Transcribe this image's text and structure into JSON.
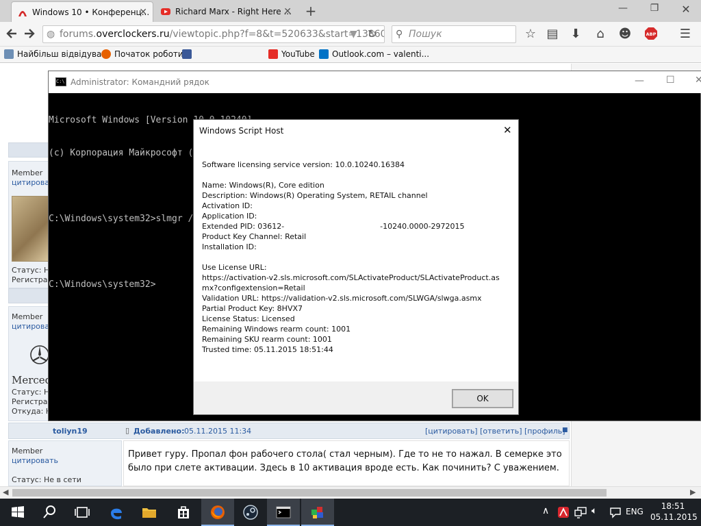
{
  "browser": {
    "tabs": [
      {
        "title": "Windows 10 • Конференц...",
        "active": true
      },
      {
        "title": "Richard Marx - Right Here ...",
        "active": false
      }
    ],
    "url_prefix": "forums.",
    "url_domain": "overclockers.ru",
    "url_path": "/viewtopic.php?f=8&t=520633&start=13860",
    "search_placeholder": "Пошук",
    "bookmarks": [
      "Найбільш відвідувані",
      "Початок роботи",
      "YouTube",
      "Outlook.com – valenti..."
    ]
  },
  "forum": {
    "posts": [
      {
        "role": "Member",
        "quote": "цитировать",
        "status": "Статус: Н",
        "reg": "Регистрац"
      },
      {
        "role": "Member",
        "quote": "цитировать",
        "avatar_text": "Mercede",
        "status": "Статус: Н",
        "reg": "Регистрац",
        "from": "Откуда: Н"
      }
    ],
    "last_post": {
      "author": "toliyn19",
      "added_label": "Добавлено:",
      "added_date": "05.11.2015 11:34",
      "actions": "[цитировать] [ответить] [профиль]",
      "role": "Member",
      "quote": "цитировать",
      "status": "Статус: Не в сети",
      "text_line1": "Привет гуру. Пропал фон рабочего стола( стал черным). Где то не то нажал. В семерке это",
      "text_line2": "было при слете активации. Здесь в 10 активация вроде есть. Как починить? С уважением."
    }
  },
  "cmd": {
    "title": "Administrator: Командний рядок",
    "lines": [
      "Microsoft Windows [Version 10.0.10240]",
      "(c) Корпорация Майкрософт (Microsoft Corporation), 2015 р. Усі права захищені.",
      "",
      "C:\\Windows\\system32>slmgr /",
      "",
      "C:\\Windows\\system32>"
    ]
  },
  "dialog": {
    "title": "Windows Script Host",
    "body": "Software licensing service version: 10.0.10240.16384\n\nName: Windows(R), Core edition\nDescription: Windows(R) Operating System, RETAIL channel\nActivation ID: \nApplication ID: \nExtended PID: 03612-                                        -10240.0000-2972015\nProduct Key Channel: Retail\nInstallation ID: \n\nUse License URL:\nhttps://activation-v2.sls.microsoft.com/SLActivateProduct/SLActivateProduct.as\nmx?configextension=Retail\nValidation URL: https://validation-v2.sls.microsoft.com/SLWGA/slwga.asmx\nPartial Product Key: 8HVX7\nLicense Status: Licensed\nRemaining Windows rearm count: 1001\nRemaining SKU rearm count: 1001\nTrusted time: 05.11.2015 18:51:44",
    "ok": "OK"
  },
  "taskbar": {
    "lang": "ENG",
    "time": "18:51",
    "date": "05.11.2015"
  },
  "colors": {
    "taskbar": "#1c2025",
    "cmd_bg": "#000000",
    "link": "#2a5aa0",
    "post_bg": "#edf1f6"
  }
}
